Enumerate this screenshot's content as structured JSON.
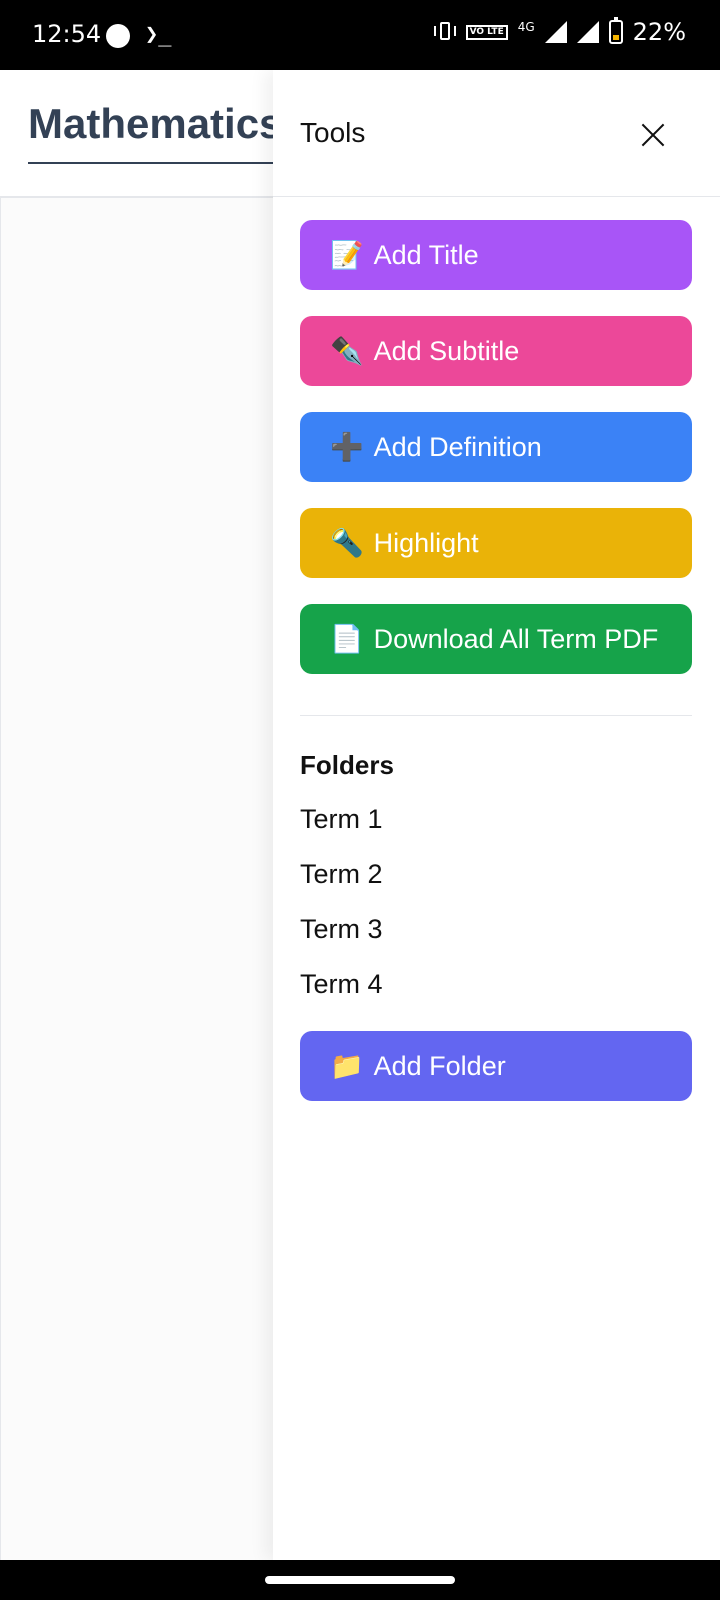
{
  "status_bar": {
    "time": "12:54",
    "terminal_glyph": "❯_",
    "volte": "VO LTE",
    "network": "4G",
    "battery_percent": "22%",
    "battery_level": 0.22
  },
  "page": {
    "title": "Mathematics"
  },
  "drawer": {
    "title": "Tools",
    "tools": [
      {
        "emoji": "📝",
        "label": "Add Title",
        "color": "#a855f7"
      },
      {
        "emoji": "✒️",
        "label": "Add Subtitle",
        "color": "#ec4899"
      },
      {
        "emoji": "➕",
        "label": "Add Definition",
        "color": "#3b82f6"
      },
      {
        "emoji": "🔦",
        "label": "Highlight",
        "color": "#eab308"
      },
      {
        "emoji": "📄",
        "label": "Download All Term PDF",
        "color": "#16a34a"
      }
    ],
    "folders_heading": "Folders",
    "folders": [
      "Term 1",
      "Term 2",
      "Term 3",
      "Term 4"
    ],
    "add_folder": {
      "emoji": "📁",
      "label": "Add Folder",
      "color": "#6366f1"
    }
  }
}
